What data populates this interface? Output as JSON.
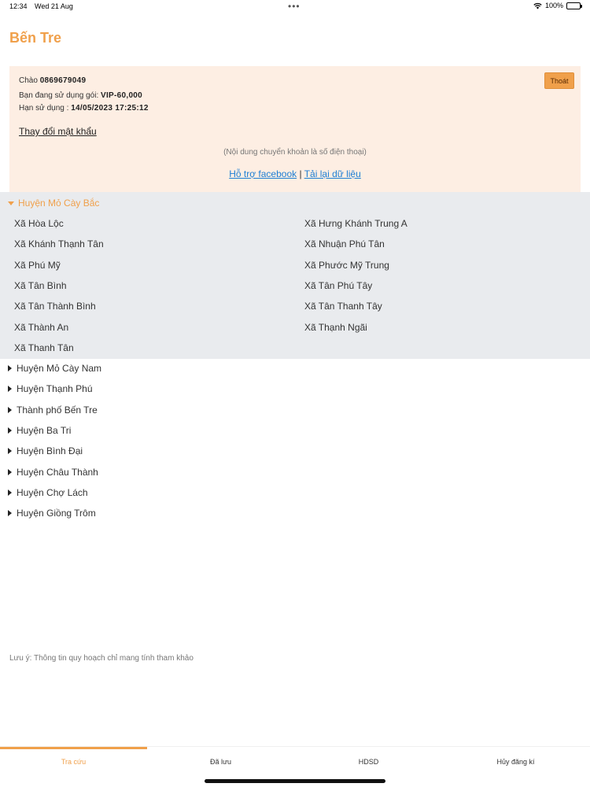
{
  "status_bar": {
    "time": "12:34",
    "date": "Wed 21 Aug",
    "battery": "100%"
  },
  "page_title": "Bến Tre",
  "account": {
    "greeting_label": "Chào",
    "phone": "0869679049",
    "package_label": "Bạn đang sử dụng gói:",
    "package": "VIP-60,000",
    "expiry_label": "Hạn sử dụng :",
    "expiry": "14/05/2023 17:25:12",
    "logout_label": "Thoát",
    "change_password_label": "Thay đổi mật khẩu",
    "transfer_note": "(Nội dung chuyển khoản là số điện thoại)",
    "support_link": "Hỗ trợ facebook",
    "separator": "|",
    "reload_link": "Tải lại dữ liệu"
  },
  "open_district": {
    "name": "Huyện Mỏ Cày Bắc",
    "communes_left": [
      "Xã Hòa Lộc",
      "Xã Khánh Thạnh Tân",
      "Xã Phú Mỹ",
      "Xã Tân Bình",
      "Xã Tân Thành Bình",
      "Xã Thành An",
      "Xã Thanh Tân"
    ],
    "communes_right": [
      "Xã Hưng Khánh Trung A",
      "Xã Nhuận Phú Tân",
      "Xã Phước Mỹ Trung",
      "Xã Tân Phú Tây",
      "Xã Tân Thanh Tây",
      "Xã Thạnh Ngãi"
    ]
  },
  "districts": [
    "Huyện Mỏ Cày Nam",
    "Huyện Thạnh Phú",
    "Thành phố Bến Tre",
    "Huyện Ba Tri",
    "Huyện Bình Đại",
    "Huyện Châu Thành",
    "Huyện Chợ Lách",
    "Huyện Giồng Trôm"
  ],
  "disclaimer": "Lưu ý: Thông tin quy hoạch chỉ mang tính tham khảo",
  "tabs": [
    {
      "label": "Tra cứu"
    },
    {
      "label": "Đã lưu"
    },
    {
      "label": "HDSD"
    },
    {
      "label": "Hủy đăng kí"
    }
  ],
  "colors": {
    "accent": "#f0a04b",
    "card_bg": "#fdeee3",
    "list_bg": "#e9ebee",
    "link": "#1e7fd4"
  }
}
